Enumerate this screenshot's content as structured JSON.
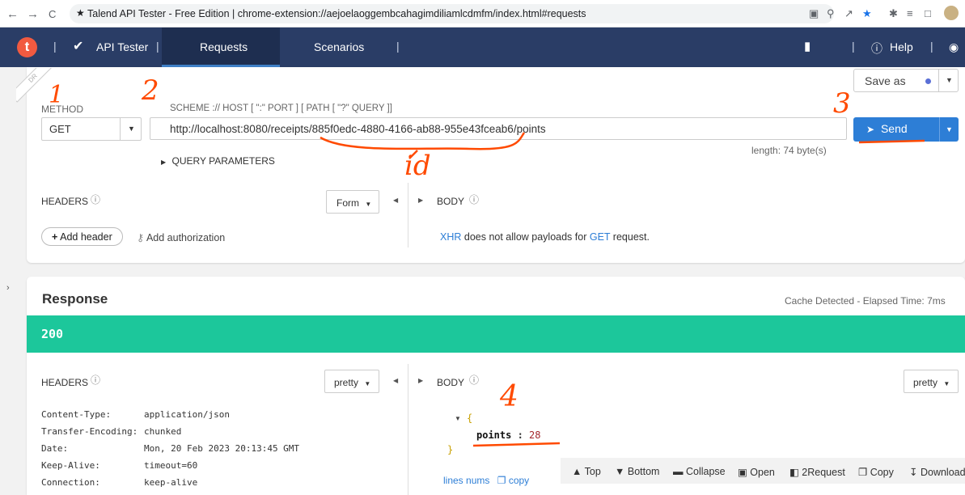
{
  "browser": {
    "back": "←",
    "forward": "→",
    "reload": "C",
    "address": "Talend API Tester - Free Edition | chrome-extension://aejoelaoggembcahagimdiliamlcdmfm/index.html#requests"
  },
  "app_nav": {
    "logo": "t",
    "api_tester": "API Tester",
    "tab_requests": "Requests",
    "tab_scenarios": "Scenarios",
    "help": "Help"
  },
  "request": {
    "draft": "DR",
    "method_label": "METHOD",
    "method_value": "GET",
    "scheme_label": "SCHEME :// HOST [ \":\" PORT ] [ PATH [ \"?\" QUERY ]]",
    "url": "http://localhost:8080/receipts/885f0edc-4880-4166-ab88-955e43fceab6/points",
    "length": "length: 74 byte(s)",
    "save_as": "Save as",
    "send": "Send",
    "query_params": "QUERY PARAMETERS",
    "headers_label": "HEADERS",
    "form_label": "Form",
    "body_label": "BODY",
    "add_header": "Add header",
    "add_authorization": "Add authorization",
    "xhr_link": "XHR",
    "xhr_msg_mid": " does not allow payloads for ",
    "get_link": "GET",
    "xhr_msg_end": " request."
  },
  "response": {
    "title": "Response",
    "cache_info": "Cache Detected - Elapsed Time: 7ms",
    "status_code": "200",
    "headers_label": "HEADERS",
    "body_label": "BODY",
    "pretty": "pretty",
    "headers": [
      {
        "key": "Content-Type:",
        "value": "application/json"
      },
      {
        "key": "Transfer-Encoding:",
        "value": "chunked"
      },
      {
        "key": "Date:",
        "value": "Mon, 20 Feb 2023 20:13:45 GMT"
      },
      {
        "key": "Keep-Alive:",
        "value": "timeout=60"
      },
      {
        "key": "Connection:",
        "value": "keep-alive"
      }
    ],
    "json_open": "{",
    "json_key": "points",
    "json_colon": " : ",
    "json_value": "28",
    "json_close": "}",
    "lines_nums": "lines nums",
    "copy_link": "copy",
    "toolbar": [
      "Top",
      "Bottom",
      "Collapse",
      "Open",
      "2Request",
      "Copy",
      "Download"
    ]
  },
  "annotations": {
    "a1": "1",
    "a2": "2",
    "a3": "3",
    "a4": "4",
    "id": "id"
  },
  "colors": {
    "nav": "#2a3d66",
    "send": "#2d7ed6",
    "status": "#1cc79b",
    "annotation": "#ff4a00"
  }
}
